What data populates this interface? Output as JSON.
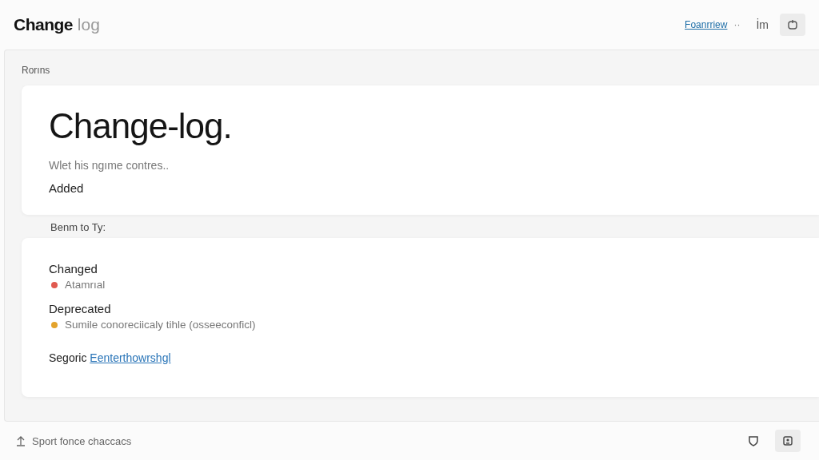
{
  "header": {
    "title_bold": "Change",
    "title_light": "log",
    "link": "Foanrriew",
    "dots": "··",
    "glyph": "İm"
  },
  "panel": {
    "label": "Rorıns"
  },
  "intro": {
    "heading": "Change-log.",
    "subtitle": "Wlet his ngıme contres..",
    "section": "Added"
  },
  "between": "Benm to Ty:",
  "groups": [
    {
      "title": "Changed",
      "items": [
        {
          "text": "Atamrıal",
          "color": "#e05a50"
        }
      ]
    },
    {
      "title": "Deprecated",
      "items": [
        {
          "text": "Sumile conoreciicaly tihle (osseeconficl)",
          "color": "#e3a32c"
        }
      ]
    }
  ],
  "footer_line": {
    "text": "Segoric",
    "link": "Eenterthowrshgl"
  },
  "status": {
    "text": "Sport fonce chaccacs"
  }
}
